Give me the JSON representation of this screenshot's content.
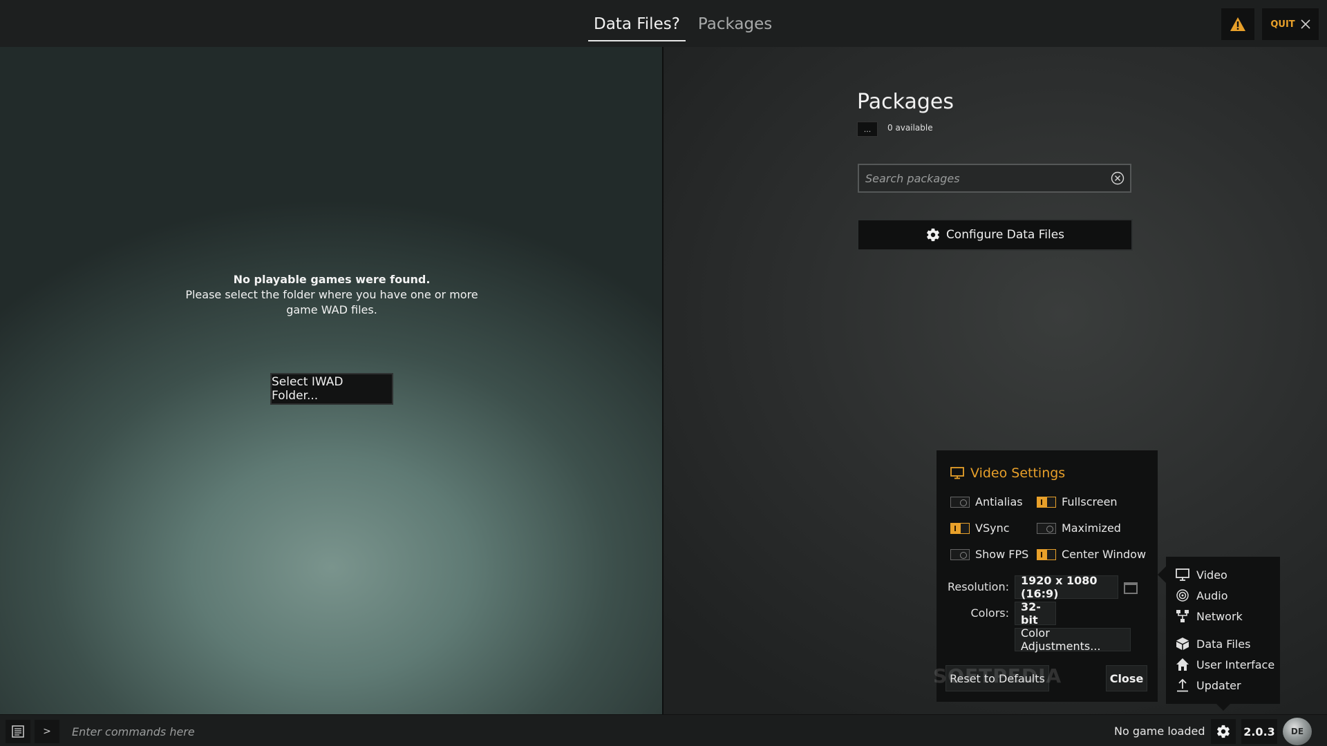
{
  "tabs": [
    {
      "label": "Data Files?",
      "active": true
    },
    {
      "label": "Packages",
      "active": false
    }
  ],
  "quit_label": "QUIT",
  "accent_color": "#e8a02a",
  "left": {
    "headline": "No playable games were found.",
    "line1": "Please select the folder where you have one or more",
    "line2": "game WAD files.",
    "select_button": "Select IWAD Folder..."
  },
  "packages": {
    "title": "Packages",
    "menu_button": "...",
    "count": "0 available",
    "search_placeholder": "Search packages",
    "configure_button": "Configure Data Files"
  },
  "video": {
    "title": "Video Settings",
    "options": {
      "antialias": {
        "label": "Antialias",
        "on": false
      },
      "fullscreen": {
        "label": "Fullscreen",
        "on": true
      },
      "vsync": {
        "label": "VSync",
        "on": true
      },
      "maximized": {
        "label": "Maximized",
        "on": false
      },
      "show_fps": {
        "label": "Show FPS",
        "on": false
      },
      "center_window": {
        "label": "Center Window",
        "on": true
      }
    },
    "resolution_label": "Resolution:",
    "resolution_value": "1920 x 1080 (16:9)",
    "colors_label": "Colors:",
    "colors_value": "32-bit",
    "color_adjust_button": "Color Adjustments...",
    "reset_button": "Reset to Defaults",
    "close_button": "Close",
    "watermark": "SOFTPEDIA"
  },
  "menu": {
    "video": "Video",
    "audio": "Audio",
    "network": "Network",
    "data_files": "Data Files",
    "user_interface": "User Interface",
    "updater": "Updater"
  },
  "bottom": {
    "prompt": ">",
    "command_placeholder": "Enter commands here",
    "status": "No game loaded",
    "version": "2.0.3",
    "logo_text": "DE"
  }
}
